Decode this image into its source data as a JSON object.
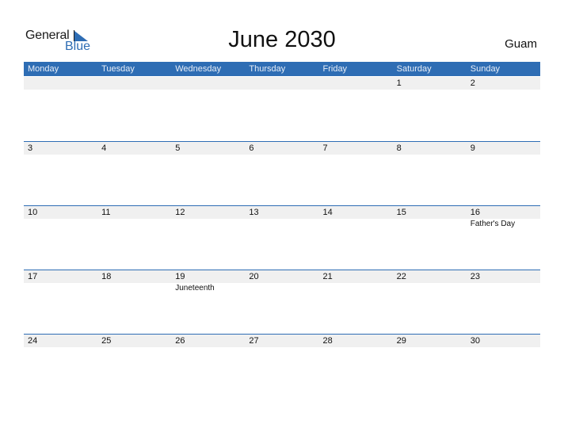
{
  "logo": {
    "word1": "General",
    "word2": "Blue"
  },
  "title": "June 2030",
  "region": "Guam",
  "colors": {
    "accent": "#2e6db4",
    "row_shade": "#f0f0f0"
  },
  "days": [
    "Monday",
    "Tuesday",
    "Wednesday",
    "Thursday",
    "Friday",
    "Saturday",
    "Sunday"
  ],
  "weeks": [
    {
      "dates": [
        "",
        "",
        "",
        "",
        "",
        "1",
        "2"
      ],
      "holidays": [
        "",
        "",
        "",
        "",
        "",
        "",
        ""
      ]
    },
    {
      "dates": [
        "3",
        "4",
        "5",
        "6",
        "7",
        "8",
        "9"
      ],
      "holidays": [
        "",
        "",
        "",
        "",
        "",
        "",
        ""
      ]
    },
    {
      "dates": [
        "10",
        "11",
        "12",
        "13",
        "14",
        "15",
        "16"
      ],
      "holidays": [
        "",
        "",
        "",
        "",
        "",
        "",
        "Father's Day"
      ]
    },
    {
      "dates": [
        "17",
        "18",
        "19",
        "20",
        "21",
        "22",
        "23"
      ],
      "holidays": [
        "",
        "",
        "Juneteenth",
        "",
        "",
        "",
        ""
      ]
    },
    {
      "dates": [
        "24",
        "25",
        "26",
        "27",
        "28",
        "29",
        "30"
      ],
      "holidays": [
        "",
        "",
        "",
        "",
        "",
        "",
        ""
      ]
    }
  ]
}
